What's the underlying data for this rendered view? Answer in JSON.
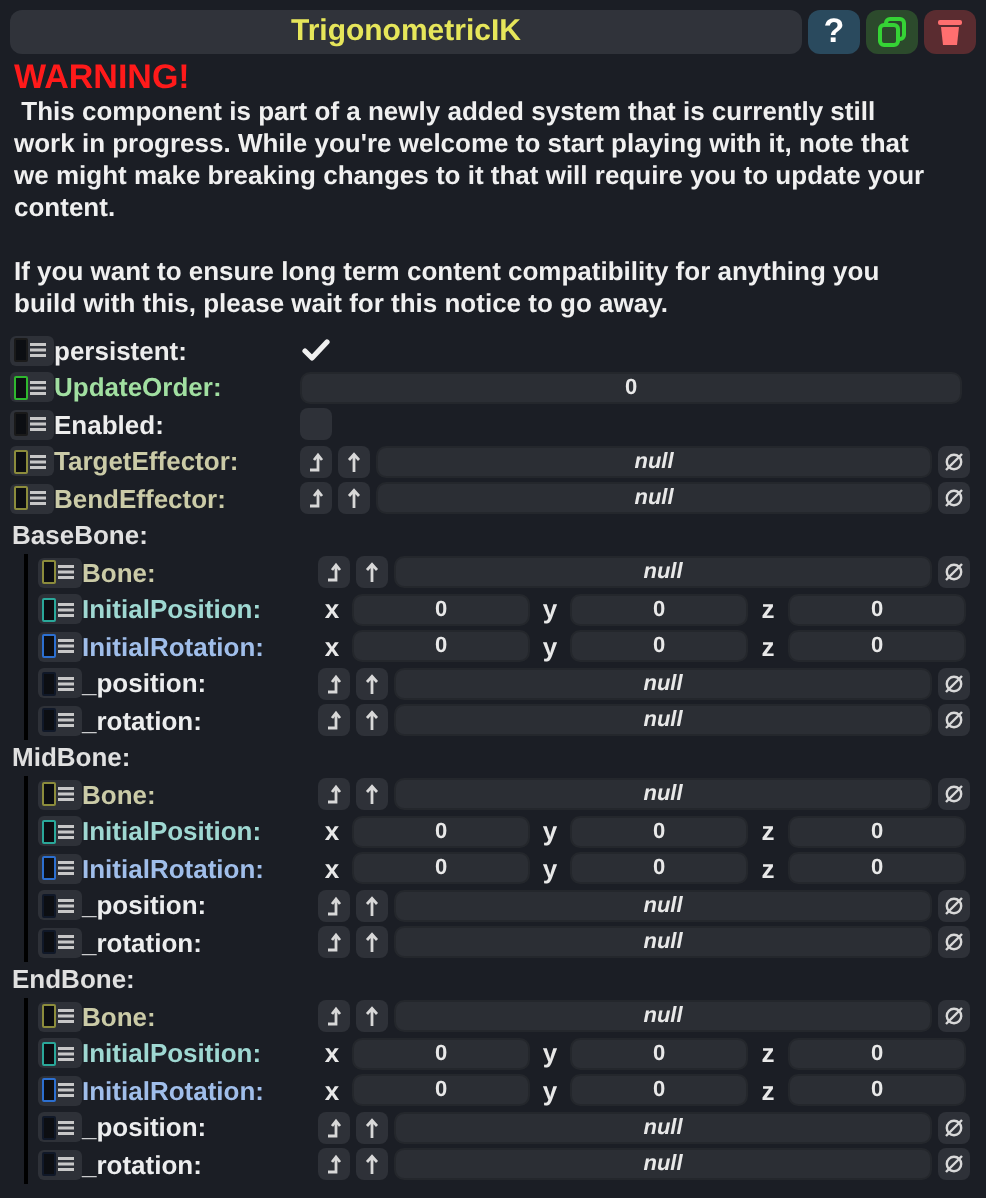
{
  "title": "TrigonometricIK",
  "header_buttons": [
    {
      "kind": "help",
      "label": "?"
    },
    {
      "kind": "duplicate"
    },
    {
      "kind": "delete"
    }
  ],
  "warning": {
    "heading": "WARNING!",
    "paragraphs": [
      " This component is part of a newly added system that is currently still work in progress. While you're welcome to start playing with it, note that we might make breaking changes to it that will require you to update your content.",
      "If you want to ensure long term content compatibility for anything you build with this, please wait for this notice to go away."
    ]
  },
  "fields": [
    {
      "kind": "bool",
      "label": "persistent:",
      "color": "#1a1a1a",
      "checked": true
    },
    {
      "kind": "number",
      "label": "UpdateOrder:",
      "color": "#2fb82f",
      "value": "0"
    },
    {
      "kind": "bool",
      "label": "Enabled:",
      "color": "#1a1a1a",
      "checked": false
    },
    {
      "kind": "ref",
      "label": "TargetEffector:",
      "color": "#8c8c3c",
      "value": "null"
    },
    {
      "kind": "ref",
      "label": "BendEffector:",
      "color": "#8c8c3c",
      "value": "null"
    }
  ],
  "groups": [
    {
      "label": "BaseBone:",
      "fields": [
        {
          "kind": "ref",
          "label": "Bone:",
          "color": "#8c8c3c",
          "value": "null"
        },
        {
          "kind": "vector",
          "label": "InitialPosition:",
          "color": "#2aa89a",
          "components": [
            {
              "axis": "x",
              "value": "0"
            },
            {
              "axis": "y",
              "value": "0"
            },
            {
              "axis": "z",
              "value": "0"
            }
          ]
        },
        {
          "kind": "vector",
          "label": "InitialRotation:",
          "color": "#2c6fd0",
          "components": [
            {
              "axis": "x",
              "value": "0"
            },
            {
              "axis": "y",
              "value": "0"
            },
            {
              "axis": "z",
              "value": "0"
            }
          ]
        },
        {
          "kind": "ref",
          "label": "_position:",
          "color": "#101828",
          "value": "null"
        },
        {
          "kind": "ref",
          "label": "_rotation:",
          "color": "#101828",
          "value": "null"
        }
      ]
    },
    {
      "label": "MidBone:",
      "fields": [
        {
          "kind": "ref",
          "label": "Bone:",
          "color": "#8c8c3c",
          "value": "null"
        },
        {
          "kind": "vector",
          "label": "InitialPosition:",
          "color": "#2aa89a",
          "components": [
            {
              "axis": "x",
              "value": "0"
            },
            {
              "axis": "y",
              "value": "0"
            },
            {
              "axis": "z",
              "value": "0"
            }
          ]
        },
        {
          "kind": "vector",
          "label": "InitialRotation:",
          "color": "#2c6fd0",
          "components": [
            {
              "axis": "x",
              "value": "0"
            },
            {
              "axis": "y",
              "value": "0"
            },
            {
              "axis": "z",
              "value": "0"
            }
          ]
        },
        {
          "kind": "ref",
          "label": "_position:",
          "color": "#101828",
          "value": "null"
        },
        {
          "kind": "ref",
          "label": "_rotation:",
          "color": "#101828",
          "value": "null"
        }
      ]
    },
    {
      "label": "EndBone:",
      "fields": [
        {
          "kind": "ref",
          "label": "Bone:",
          "color": "#8c8c3c",
          "value": "null"
        },
        {
          "kind": "vector",
          "label": "InitialPosition:",
          "color": "#2aa89a",
          "components": [
            {
              "axis": "x",
              "value": "0"
            },
            {
              "axis": "y",
              "value": "0"
            },
            {
              "axis": "z",
              "value": "0"
            }
          ]
        },
        {
          "kind": "vector",
          "label": "InitialRotation:",
          "color": "#2c6fd0",
          "components": [
            {
              "axis": "x",
              "value": "0"
            },
            {
              "axis": "y",
              "value": "0"
            },
            {
              "axis": "z",
              "value": "0"
            }
          ]
        },
        {
          "kind": "ref",
          "label": "_position:",
          "color": "#101828",
          "value": "null"
        },
        {
          "kind": "ref",
          "label": "_rotation:",
          "color": "#101828",
          "value": "null"
        }
      ]
    }
  ]
}
